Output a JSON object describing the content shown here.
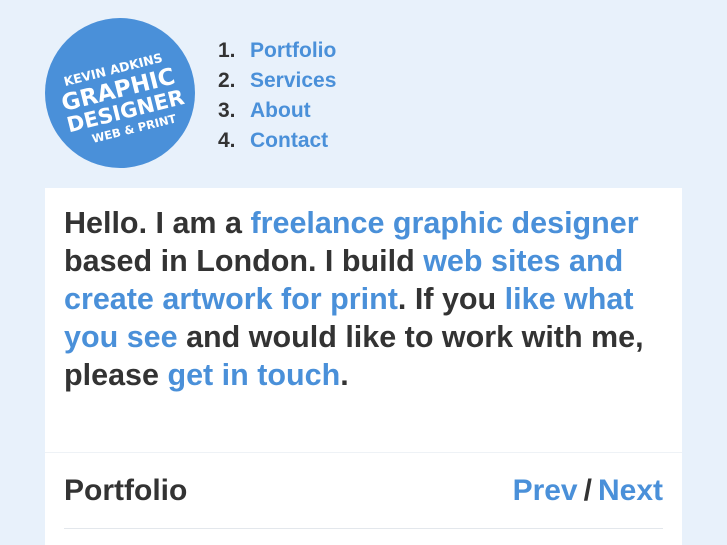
{
  "logo": {
    "line1": "KEVIN ADKINS",
    "line2": "GRAPHIC",
    "line3": "DESIGNER",
    "line4": "WEB & PRINT",
    "color": "#4a90d9"
  },
  "nav": {
    "items": [
      {
        "number": "1.",
        "label": "Portfolio"
      },
      {
        "number": "2.",
        "label": "Services"
      },
      {
        "number": "3.",
        "label": "About"
      },
      {
        "number": "4.",
        "label": "Contact"
      }
    ]
  },
  "intro": {
    "t1": "Hello. I am a ",
    "l1": "freelance graphic designer",
    "t2": " based in London. I build ",
    "l2": "web sites and create artwork for print",
    "t3": ". If you ",
    "l3": "like what you see",
    "t4": " and would like to work with me, please ",
    "l4": "get in touch",
    "t5": "."
  },
  "portfolio": {
    "title": "Portfolio",
    "prev": "Prev",
    "separator": "/",
    "next": "Next"
  },
  "colors": {
    "background": "#e8f1fb",
    "accent": "#4a90d9",
    "text": "#333333"
  }
}
